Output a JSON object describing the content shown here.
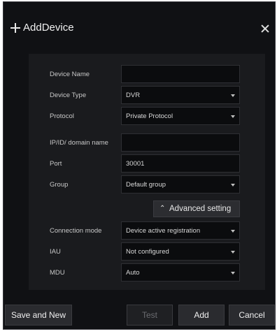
{
  "dialog": {
    "title": "AddDevice"
  },
  "form": {
    "device_name": {
      "label": "Device Name",
      "value": ""
    },
    "device_type": {
      "label": "Device Type",
      "value": "DVR"
    },
    "protocol": {
      "label": "Protocol",
      "value": "Private Protocol"
    },
    "ip_domain": {
      "label": "IP/ID/ domain name",
      "value": ""
    },
    "port": {
      "label": "Port",
      "value": "30001"
    },
    "group": {
      "label": "Group",
      "value": "Default group"
    },
    "advanced_setting": "Advanced setting",
    "connection_mode": {
      "label": "Connection mode",
      "value": "Device active registration"
    },
    "iau": {
      "label": "IAU",
      "value": "Not configured"
    },
    "mdu": {
      "label": "MDU",
      "value": "Auto"
    }
  },
  "footer": {
    "save_and_new": "Save and New",
    "test": "Test",
    "add": "Add",
    "cancel": "Cancel"
  },
  "icons": {
    "title_icon": "plus-icon",
    "close": "close-icon",
    "advanced": "double-chevron-up-icon",
    "dropdown": "caret-down-icon"
  }
}
